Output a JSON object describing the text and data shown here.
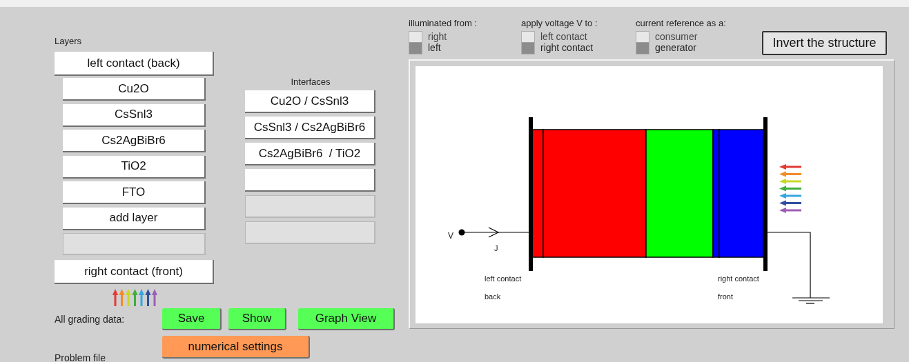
{
  "layers_panel": {
    "title": "Layers",
    "items": [
      {
        "kind": "contact",
        "label": "left contact (back)"
      },
      {
        "kind": "layer",
        "label": "Cu2O"
      },
      {
        "kind": "layer",
        "label": "CsSnl3"
      },
      {
        "kind": "layer",
        "label": "Cs2AgBiBr6"
      },
      {
        "kind": "layer",
        "label": "TiO2"
      },
      {
        "kind": "layer",
        "label": "FTO"
      },
      {
        "kind": "layer",
        "label": "add layer"
      },
      {
        "kind": "empty"
      },
      {
        "kind": "contact",
        "label": "right contact (front)"
      }
    ]
  },
  "interfaces_panel": {
    "title": "Interfaces",
    "items": [
      {
        "label": "Cu2O / CsSnl3",
        "disabled": false
      },
      {
        "label": "CsSnl3 / Cs2AgBiBr6",
        "disabled": false
      },
      {
        "label": "Cs2AgBiBr6  / TiO2",
        "disabled": false
      },
      {
        "disabled": false
      },
      {
        "disabled": true
      },
      {
        "disabled": true
      }
    ]
  },
  "grading": {
    "label": "All grading data:",
    "buttons": [
      "Save",
      "Show",
      "Graph View"
    ]
  },
  "numerical_settings": "numerical settings",
  "problem_file_label": "Problem file",
  "options": [
    {
      "title": "illuminated from :",
      "choices": [
        {
          "label": "right",
          "selected": false
        },
        {
          "label": "left",
          "selected": true
        }
      ]
    },
    {
      "title": "apply voltage V to :",
      "choices": [
        {
          "label": "left contact",
          "selected": false
        },
        {
          "label": "right contact",
          "selected": true
        }
      ]
    },
    {
      "title": "current reference as a:",
      "choices": [
        {
          "label": "consumer",
          "selected": false
        },
        {
          "label": "generator",
          "selected": true
        }
      ]
    }
  ],
  "invert_button": "Invert the structure",
  "diagram": {
    "layers": [
      {
        "color": "#ff0000"
      },
      {
        "color": "#ff0000"
      },
      {
        "color": "#00ff00"
      },
      {
        "color": "#0000ff"
      },
      {
        "color": "#0000ff"
      }
    ],
    "v_label": "V",
    "j_label": "J",
    "left_labels": [
      "left contact",
      "back"
    ],
    "right_labels": [
      "right contact",
      "front"
    ]
  }
}
